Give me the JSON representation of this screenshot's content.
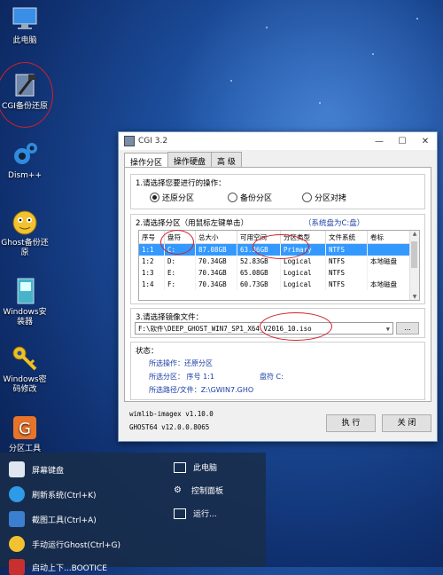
{
  "desktop": {
    "icons": [
      {
        "label": "此电脑",
        "icon": "this-pc-icon"
      },
      {
        "label": "CGI备份还原",
        "icon": "cgi-backup-icon"
      },
      {
        "label": "Dism++",
        "icon": "dism-icon"
      },
      {
        "label": "Ghost备份还原",
        "icon": "ghost-icon"
      },
      {
        "label": "Windows安装器",
        "icon": "windows-installer-icon"
      },
      {
        "label": "Windows密码修改",
        "icon": "password-key-icon"
      },
      {
        "label": "分区工具",
        "icon": "partition-tool-icon"
      }
    ]
  },
  "window": {
    "title": "CGI 3.2",
    "controls": {
      "minimize": "—",
      "maximize": "☐",
      "close": "✕"
    },
    "tabs": [
      "操作分区",
      "操作硬盘",
      "高 级"
    ],
    "section1": {
      "label": "1.请选择您要进行的操作：",
      "options": [
        "还原分区",
        "备份分区",
        "分区对拷"
      ],
      "selected": "还原分区"
    },
    "section2": {
      "label": "2.请选择分区（用鼠标左键单击）",
      "hint": "（系统盘为C:盘）",
      "columns": [
        "序号",
        "盘符",
        "总大小",
        "可用空间",
        "分区类型",
        "文件系统",
        "卷标"
      ],
      "rows": [
        [
          "1:1",
          "C:",
          "87.08GB",
          "63.36GB",
          "Primary",
          "NTFS",
          ""
        ],
        [
          "1:2",
          "D:",
          "70.34GB",
          "52.83GB",
          "Logical",
          "NTFS",
          "本地磁盘"
        ],
        [
          "1:3",
          "E:",
          "70.34GB",
          "65.08GB",
          "Logical",
          "NTFS",
          ""
        ],
        [
          "1:4",
          "F:",
          "70.34GB",
          "60.73GB",
          "Logical",
          "NTFS",
          "本地磁盘"
        ]
      ],
      "selected_row": 0
    },
    "section3": {
      "label": "3.请选择镜像文件：",
      "path": "F:\\软件\\DEEP_GHOST_WIN7_SP1_X64_V2016_10.iso",
      "browse_label": "..."
    },
    "status": {
      "label": "状态：",
      "line1": "所选操作：还原分区",
      "line2_a": "所选分区：  序号 1:1",
      "line2_b": "盘符 C:",
      "line3": "所选路径/文件：Z:\\GWIN7.GHO"
    },
    "footer": {
      "line1": "wimlib-imagex v1.10.0",
      "line2": "GHOST64 v12.0.0.8065",
      "run_label": "执 行",
      "close_label": "关 闭"
    }
  },
  "startmenu": {
    "left": [
      {
        "label": "屏幕键盘",
        "icon": "keyboard-icon"
      },
      {
        "label": "刷新系统(Ctrl+K)",
        "icon": "refresh-icon"
      },
      {
        "label": "截图工具(Ctrl+A)",
        "icon": "screenshot-icon"
      },
      {
        "label": "手动运行Ghost(Ctrl+G)",
        "icon": "ghost-run-icon"
      },
      {
        "label": "启动上下...BOOTICE",
        "icon": "bootice-icon"
      }
    ],
    "right": [
      {
        "label": "此电脑",
        "icon": "computer-icon"
      },
      {
        "label": "控制面板",
        "icon": "control-panel-icon"
      },
      {
        "label": "运行...",
        "icon": "run-icon"
      }
    ]
  },
  "colors": {
    "selection": "#3399ff",
    "status_text": "#1a3ea6",
    "hint_text": "#1a3ea6",
    "annotation": "#d0202a"
  }
}
